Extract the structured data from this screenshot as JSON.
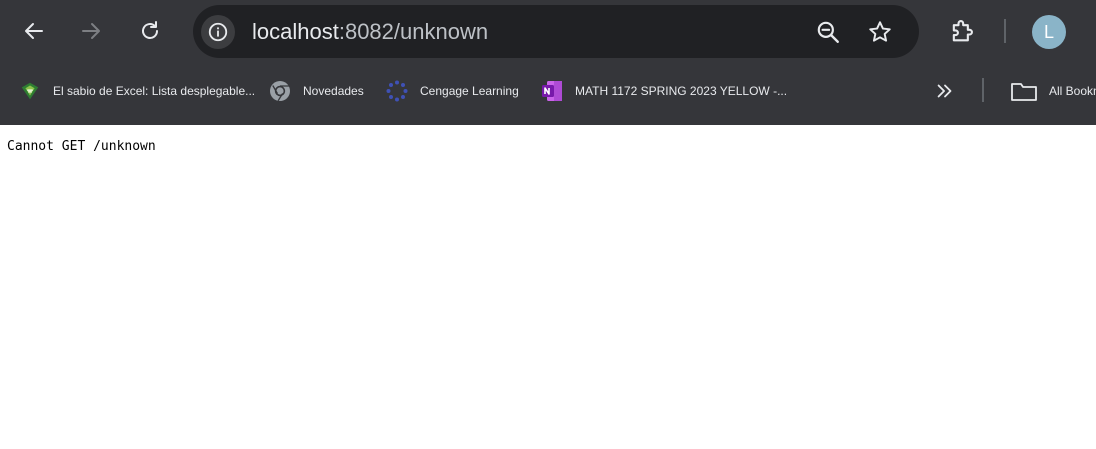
{
  "browser": {
    "address_bar": {
      "host": "localhost",
      "rest": ":8082/unknown"
    },
    "profile_initial": "L",
    "bookmarks": [
      {
        "label": "El sabio de Excel: Lista desplegable...",
        "icon": "excel-sabio-icon"
      },
      {
        "label": "Novedades",
        "icon": "chrome-icon"
      },
      {
        "label": "Cengage Learning",
        "icon": "cengage-icon"
      },
      {
        "label": "MATH 1172 SPRING 2023 YELLOW -...",
        "icon": "onenote-icon"
      }
    ],
    "all_bookmarks_label": "All Bookmarks",
    "colors": {
      "chrome_bg": "#35363a",
      "omnibox_bg": "#202124",
      "text": "#e8eaed",
      "page_bg": "#ffffff"
    }
  },
  "page": {
    "message": "Cannot GET /unknown"
  }
}
